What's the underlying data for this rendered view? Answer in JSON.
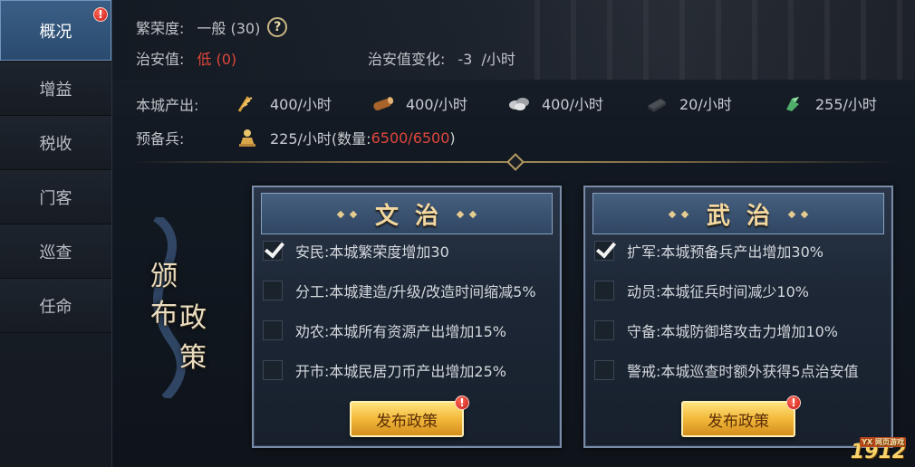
{
  "sidebar": {
    "items": [
      {
        "label": "概况",
        "active": true,
        "badge": "!"
      },
      {
        "label": "增益"
      },
      {
        "label": "税收"
      },
      {
        "label": "门客"
      },
      {
        "label": "巡查"
      },
      {
        "label": "任命"
      }
    ]
  },
  "status": {
    "prosperity_label": "繁荣度:",
    "prosperity_value": "一般 (30)",
    "help_icon": "?",
    "security_label": "治安值:",
    "security_value": "低 (0)",
    "security_change_label": "治安值变化:",
    "security_change_value": "-3  /小时"
  },
  "output": {
    "label": "本城产出:",
    "resources": [
      {
        "icon": "grain-icon",
        "value": "400/小时"
      },
      {
        "icon": "wood-icon",
        "value": "400/小时"
      },
      {
        "icon": "stone-icon",
        "value": "400/小时"
      },
      {
        "icon": "iron-icon",
        "value": "20/小时"
      },
      {
        "icon": "money-icon",
        "value": "255/小时"
      }
    ]
  },
  "reserve": {
    "label": "预备兵:",
    "rate": "225/小时(数量: ",
    "count": "6500/6500",
    "close": ")"
  },
  "banner": {
    "chars": [
      "颁",
      "布",
      "政",
      "策"
    ]
  },
  "civil": {
    "title": "文治",
    "policies": [
      {
        "text": "安民:本城繁荣度增加30",
        "checked": true
      },
      {
        "text": "分工:本城建造/升级/改造时间缩减5%",
        "checked": false
      },
      {
        "text": "劝农:本城所有资源产出增加15%",
        "checked": false
      },
      {
        "text": "开市:本城民居刀币产出增加25%",
        "checked": false
      }
    ],
    "button": "发布政策",
    "button_badge": "!"
  },
  "military": {
    "title": "武治",
    "policies": [
      {
        "text": "扩军:本城预备兵产出增加30%",
        "checked": true
      },
      {
        "text": "动员:本城征兵时间减少10%",
        "checked": false
      },
      {
        "text": "守备:本城防御塔攻击力增加10%",
        "checked": false
      },
      {
        "text": "警戒:本城巡查时额外获得5点治安值",
        "checked": false
      }
    ],
    "button": "发布政策",
    "button_badge": "!"
  },
  "watermark": {
    "text": "1912",
    "sub": "YX 网页游戏"
  }
}
